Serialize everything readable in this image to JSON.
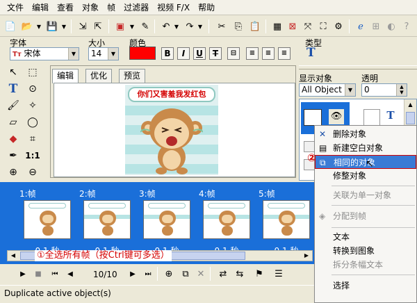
{
  "menu": [
    "文件",
    "编辑",
    "查看",
    "对象",
    "帧",
    "过滤器",
    "视频 F/X",
    "帮助"
  ],
  "props": {
    "font_label": "字体",
    "font_value": "宋体",
    "size_label": "大小",
    "size_value": "14",
    "color_label": "颜色",
    "color_value": "#ff0000",
    "bold": "B",
    "italic": "I",
    "underline": "U",
    "strike": "T",
    "type_label": "类型",
    "type_value": "T"
  },
  "editor": {
    "tabs": [
      "编辑",
      "优化",
      "预览"
    ],
    "banner_text": "你们又害羞我发红包"
  },
  "right_panel": {
    "show_label": "显示对象",
    "show_value": "All Object",
    "opacity_label": "透明",
    "opacity_value": "0"
  },
  "timeline": {
    "frames": [
      {
        "label": "1:帧",
        "duration": "0.1 秒"
      },
      {
        "label": "2:帧",
        "duration": "0.1 秒"
      },
      {
        "label": "3:帧",
        "duration": "0.1 秒"
      },
      {
        "label": "4:帧",
        "duration": "0.1 秒"
      },
      {
        "label": "5:帧",
        "duration": "0.1 秒"
      }
    ],
    "annotation": "①全选所有帧（按Ctrl键可多选）"
  },
  "playbar": {
    "counter": "10/10"
  },
  "status": {
    "text": "Duplicate active object(s)"
  },
  "context_menu": {
    "items": [
      {
        "label": "删除对象",
        "enabled": true,
        "icon": "delete-x-icon"
      },
      {
        "label": "新建空白对象",
        "enabled": true,
        "icon": "new-object-icon"
      },
      {
        "label": "相同的对象",
        "enabled": true,
        "icon": "duplicate-icon",
        "highlighted": true
      },
      {
        "label": "修整对象",
        "enabled": true
      },
      {
        "label": "关联为单一对象",
        "enabled": false
      },
      {
        "label": "分配到帧",
        "enabled": false,
        "icon": "distribute-icon"
      },
      {
        "label": "文本",
        "enabled": true
      },
      {
        "label": "转换到图象",
        "enabled": true
      },
      {
        "label": "拆分条幅文本",
        "enabled": false
      },
      {
        "label": "选择",
        "enabled": true
      }
    ],
    "annotation_number": "②"
  },
  "colors": {
    "highlight": "#3a7bd5",
    "timeline_bg": "#1a6fd9",
    "annotation": "#d40000"
  }
}
